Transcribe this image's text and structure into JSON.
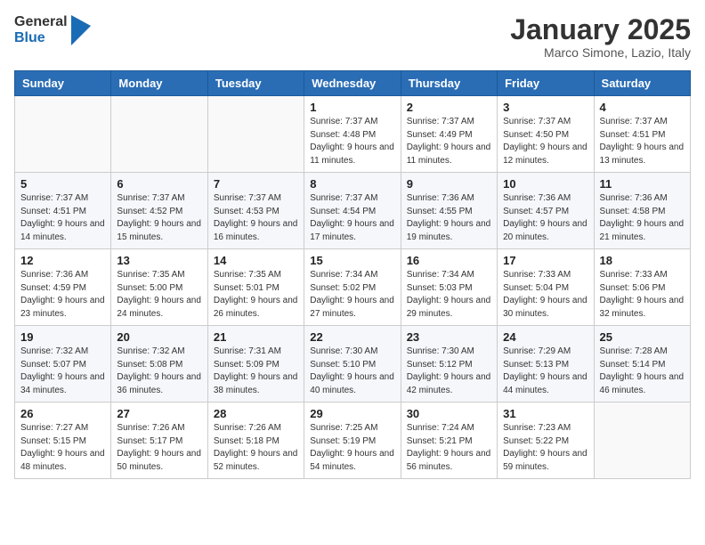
{
  "header": {
    "logo_general": "General",
    "logo_blue": "Blue",
    "month_title": "January 2025",
    "subtitle": "Marco Simone, Lazio, Italy"
  },
  "weekdays": [
    "Sunday",
    "Monday",
    "Tuesday",
    "Wednesday",
    "Thursday",
    "Friday",
    "Saturday"
  ],
  "weeks": [
    [
      {
        "day": "",
        "sunrise": "",
        "sunset": "",
        "daylight": ""
      },
      {
        "day": "",
        "sunrise": "",
        "sunset": "",
        "daylight": ""
      },
      {
        "day": "",
        "sunrise": "",
        "sunset": "",
        "daylight": ""
      },
      {
        "day": "1",
        "sunrise": "Sunrise: 7:37 AM",
        "sunset": "Sunset: 4:48 PM",
        "daylight": "Daylight: 9 hours and 11 minutes."
      },
      {
        "day": "2",
        "sunrise": "Sunrise: 7:37 AM",
        "sunset": "Sunset: 4:49 PM",
        "daylight": "Daylight: 9 hours and 11 minutes."
      },
      {
        "day": "3",
        "sunrise": "Sunrise: 7:37 AM",
        "sunset": "Sunset: 4:50 PM",
        "daylight": "Daylight: 9 hours and 12 minutes."
      },
      {
        "day": "4",
        "sunrise": "Sunrise: 7:37 AM",
        "sunset": "Sunset: 4:51 PM",
        "daylight": "Daylight: 9 hours and 13 minutes."
      }
    ],
    [
      {
        "day": "5",
        "sunrise": "Sunrise: 7:37 AM",
        "sunset": "Sunset: 4:51 PM",
        "daylight": "Daylight: 9 hours and 14 minutes."
      },
      {
        "day": "6",
        "sunrise": "Sunrise: 7:37 AM",
        "sunset": "Sunset: 4:52 PM",
        "daylight": "Daylight: 9 hours and 15 minutes."
      },
      {
        "day": "7",
        "sunrise": "Sunrise: 7:37 AM",
        "sunset": "Sunset: 4:53 PM",
        "daylight": "Daylight: 9 hours and 16 minutes."
      },
      {
        "day": "8",
        "sunrise": "Sunrise: 7:37 AM",
        "sunset": "Sunset: 4:54 PM",
        "daylight": "Daylight: 9 hours and 17 minutes."
      },
      {
        "day": "9",
        "sunrise": "Sunrise: 7:36 AM",
        "sunset": "Sunset: 4:55 PM",
        "daylight": "Daylight: 9 hours and 19 minutes."
      },
      {
        "day": "10",
        "sunrise": "Sunrise: 7:36 AM",
        "sunset": "Sunset: 4:57 PM",
        "daylight": "Daylight: 9 hours and 20 minutes."
      },
      {
        "day": "11",
        "sunrise": "Sunrise: 7:36 AM",
        "sunset": "Sunset: 4:58 PM",
        "daylight": "Daylight: 9 hours and 21 minutes."
      }
    ],
    [
      {
        "day": "12",
        "sunrise": "Sunrise: 7:36 AM",
        "sunset": "Sunset: 4:59 PM",
        "daylight": "Daylight: 9 hours and 23 minutes."
      },
      {
        "day": "13",
        "sunrise": "Sunrise: 7:35 AM",
        "sunset": "Sunset: 5:00 PM",
        "daylight": "Daylight: 9 hours and 24 minutes."
      },
      {
        "day": "14",
        "sunrise": "Sunrise: 7:35 AM",
        "sunset": "Sunset: 5:01 PM",
        "daylight": "Daylight: 9 hours and 26 minutes."
      },
      {
        "day": "15",
        "sunrise": "Sunrise: 7:34 AM",
        "sunset": "Sunset: 5:02 PM",
        "daylight": "Daylight: 9 hours and 27 minutes."
      },
      {
        "day": "16",
        "sunrise": "Sunrise: 7:34 AM",
        "sunset": "Sunset: 5:03 PM",
        "daylight": "Daylight: 9 hours and 29 minutes."
      },
      {
        "day": "17",
        "sunrise": "Sunrise: 7:33 AM",
        "sunset": "Sunset: 5:04 PM",
        "daylight": "Daylight: 9 hours and 30 minutes."
      },
      {
        "day": "18",
        "sunrise": "Sunrise: 7:33 AM",
        "sunset": "Sunset: 5:06 PM",
        "daylight": "Daylight: 9 hours and 32 minutes."
      }
    ],
    [
      {
        "day": "19",
        "sunrise": "Sunrise: 7:32 AM",
        "sunset": "Sunset: 5:07 PM",
        "daylight": "Daylight: 9 hours and 34 minutes."
      },
      {
        "day": "20",
        "sunrise": "Sunrise: 7:32 AM",
        "sunset": "Sunset: 5:08 PM",
        "daylight": "Daylight: 9 hours and 36 minutes."
      },
      {
        "day": "21",
        "sunrise": "Sunrise: 7:31 AM",
        "sunset": "Sunset: 5:09 PM",
        "daylight": "Daylight: 9 hours and 38 minutes."
      },
      {
        "day": "22",
        "sunrise": "Sunrise: 7:30 AM",
        "sunset": "Sunset: 5:10 PM",
        "daylight": "Daylight: 9 hours and 40 minutes."
      },
      {
        "day": "23",
        "sunrise": "Sunrise: 7:30 AM",
        "sunset": "Sunset: 5:12 PM",
        "daylight": "Daylight: 9 hours and 42 minutes."
      },
      {
        "day": "24",
        "sunrise": "Sunrise: 7:29 AM",
        "sunset": "Sunset: 5:13 PM",
        "daylight": "Daylight: 9 hours and 44 minutes."
      },
      {
        "day": "25",
        "sunrise": "Sunrise: 7:28 AM",
        "sunset": "Sunset: 5:14 PM",
        "daylight": "Daylight: 9 hours and 46 minutes."
      }
    ],
    [
      {
        "day": "26",
        "sunrise": "Sunrise: 7:27 AM",
        "sunset": "Sunset: 5:15 PM",
        "daylight": "Daylight: 9 hours and 48 minutes."
      },
      {
        "day": "27",
        "sunrise": "Sunrise: 7:26 AM",
        "sunset": "Sunset: 5:17 PM",
        "daylight": "Daylight: 9 hours and 50 minutes."
      },
      {
        "day": "28",
        "sunrise": "Sunrise: 7:26 AM",
        "sunset": "Sunset: 5:18 PM",
        "daylight": "Daylight: 9 hours and 52 minutes."
      },
      {
        "day": "29",
        "sunrise": "Sunrise: 7:25 AM",
        "sunset": "Sunset: 5:19 PM",
        "daylight": "Daylight: 9 hours and 54 minutes."
      },
      {
        "day": "30",
        "sunrise": "Sunrise: 7:24 AM",
        "sunset": "Sunset: 5:21 PM",
        "daylight": "Daylight: 9 hours and 56 minutes."
      },
      {
        "day": "31",
        "sunrise": "Sunrise: 7:23 AM",
        "sunset": "Sunset: 5:22 PM",
        "daylight": "Daylight: 9 hours and 59 minutes."
      },
      {
        "day": "",
        "sunrise": "",
        "sunset": "",
        "daylight": ""
      }
    ]
  ]
}
